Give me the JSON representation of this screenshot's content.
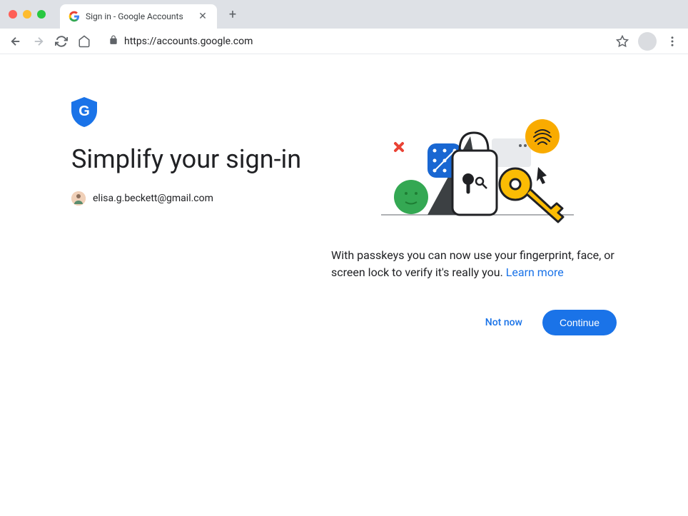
{
  "browser": {
    "tab_title": "Sign in - Google Accounts",
    "url": "https://accounts.google.com"
  },
  "page": {
    "title": "Simplify your sign-in",
    "email": "elisa.g.beckett@gmail.com",
    "description_prefix": "With passkeys you can now use your fingerprint, face, or screen lock to verify it's really you. ",
    "learn_more": "Learn more",
    "not_now": "Not now",
    "continue": "Continue"
  },
  "colors": {
    "primary": "#1a73e8",
    "text": "#202124"
  }
}
